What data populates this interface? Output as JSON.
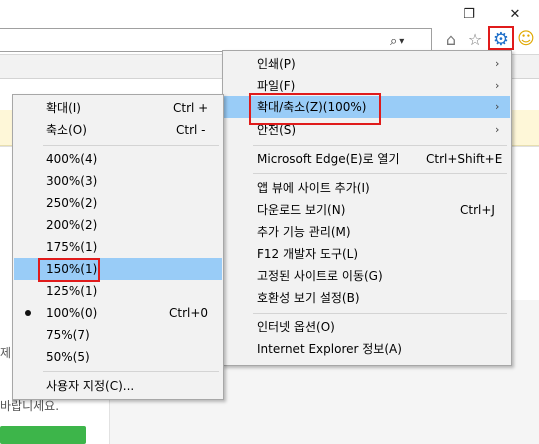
{
  "toolbar": {
    "search_glyph": "⌕",
    "dropdown_glyph": "▾",
    "home_glyph": "⌂",
    "star_glyph": "☆",
    "gear_glyph": "⚙",
    "smiley_glyph": "☺",
    "restore_glyph": "❐",
    "close_glyph": "✕"
  },
  "page": {
    "fragment_left": "제",
    "fragment_bottom": "바랍니세요."
  },
  "main_menu": {
    "items": [
      {
        "label": "인쇄(P)",
        "shortcut": "",
        "submenu": true
      },
      {
        "label": "파일(F)",
        "shortcut": "",
        "submenu": true
      },
      {
        "label": "확대/축소(Z)(100%)",
        "shortcut": "",
        "submenu": true,
        "highlighted": true
      },
      {
        "label": "안전(S)",
        "shortcut": "",
        "submenu": true
      },
      {
        "label": "Microsoft Edge(E)로 열기",
        "shortcut": "Ctrl+Shift+E",
        "submenu": false
      },
      {
        "label": "앱 뷰에 사이트 추가(I)",
        "shortcut": "",
        "submenu": false
      },
      {
        "label": "다운로드 보기(N)",
        "shortcut": "Ctrl+J",
        "submenu": false
      },
      {
        "label": "추가 기능 관리(M)",
        "shortcut": "",
        "submenu": false
      },
      {
        "label": "F12 개발자 도구(L)",
        "shortcut": "",
        "submenu": false
      },
      {
        "label": "고정된 사이트로 이동(G)",
        "shortcut": "",
        "submenu": false
      },
      {
        "label": "호환성 보기 설정(B)",
        "shortcut": "",
        "submenu": false
      },
      {
        "label": "인터넷 옵션(O)",
        "shortcut": "",
        "submenu": false
      },
      {
        "label": "Internet Explorer 정보(A)",
        "shortcut": "",
        "submenu": false
      }
    ],
    "arrow": "›"
  },
  "zoom_menu": {
    "items": [
      {
        "label": "확대(I)",
        "shortcut": "Ctrl +"
      },
      {
        "label": "축소(O)",
        "shortcut": "Ctrl -"
      },
      {
        "label": "400%(4)",
        "shortcut": ""
      },
      {
        "label": "300%(3)",
        "shortcut": ""
      },
      {
        "label": "250%(2)",
        "shortcut": ""
      },
      {
        "label": "200%(2)",
        "shortcut": ""
      },
      {
        "label": "175%(1)",
        "shortcut": ""
      },
      {
        "label": "150%(1)",
        "shortcut": "",
        "highlighted": true
      },
      {
        "label": "125%(1)",
        "shortcut": ""
      },
      {
        "label": "100%(0)",
        "shortcut": "Ctrl+0",
        "checked": true
      },
      {
        "label": "75%(7)",
        "shortcut": ""
      },
      {
        "label": "50%(5)",
        "shortcut": ""
      },
      {
        "label": "사용자 지정(C)...",
        "shortcut": ""
      }
    ]
  },
  "colors": {
    "highlight": "#99ccf7",
    "annotation_red": "#e01b1b",
    "menu_bg": "#f2f2f2",
    "gear_blue": "#1e6fc9",
    "smiley_yellow": "#f2c21b"
  }
}
